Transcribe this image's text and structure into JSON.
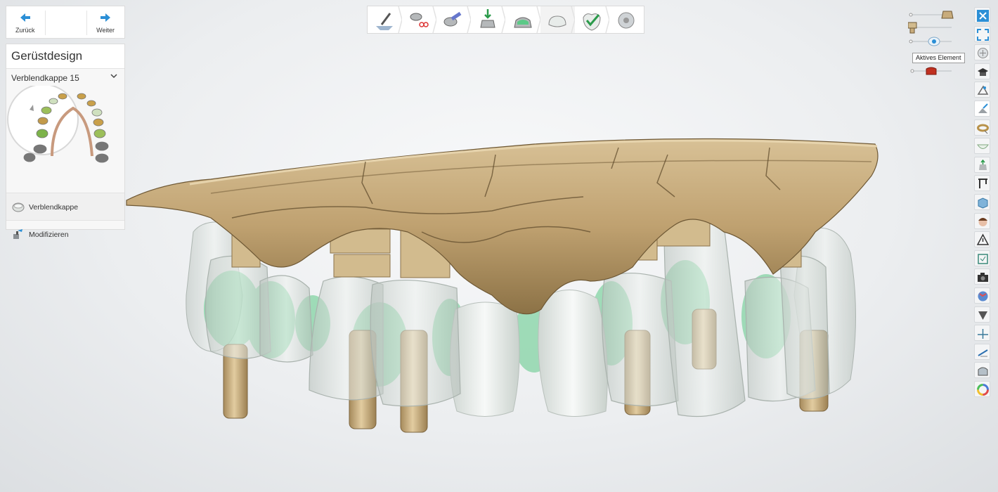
{
  "nav": {
    "back_label": "Zurück",
    "forward_label": "Weiter"
  },
  "panel": {
    "title": "Gerüstdesign",
    "dropdown_value": "Verblendkappe 15",
    "items": [
      {
        "label": "Verblendkappe",
        "icon": "coping-icon"
      },
      {
        "label": "Modifizieren",
        "icon": "modify-icon"
      }
    ]
  },
  "workflow_steps": [
    {
      "name": "margin-step",
      "icon": "margin-line-icon"
    },
    {
      "name": "cut-step",
      "icon": "scissors-icon"
    },
    {
      "name": "insertion-step",
      "icon": "insertion-axis-icon"
    },
    {
      "name": "die-step",
      "icon": "die-icon"
    },
    {
      "name": "cement-gap-step",
      "icon": "cement-gap-icon"
    },
    {
      "name": "framework-step",
      "icon": "framework-icon",
      "active": true
    },
    {
      "name": "check-step",
      "icon": "check-icon"
    },
    {
      "name": "finish-step",
      "icon": "disc-icon"
    }
  ],
  "tooltip": "Aktives Element",
  "colors": {
    "accent": "#2b8fd6",
    "gingiva": "#c8ac7c",
    "tooth": "#e6ebe8",
    "green": "#5cc987",
    "red": "#c03020"
  },
  "right_tools": [
    "close-icon",
    "fullscreen-icon",
    "view-cube-icon",
    "tutorial-icon",
    "scan-icon",
    "scan-edit-icon",
    "ring-icon",
    "bowl-icon",
    "tooth-up-icon",
    "section-icon",
    "box-icon",
    "face-icon",
    "warning-icon",
    "frame-icon",
    "camera-icon",
    "color-map-icon",
    "shield-icon",
    "axis-icon",
    "ruler-icon",
    "jaw-icon",
    "color-wheel-icon"
  ]
}
